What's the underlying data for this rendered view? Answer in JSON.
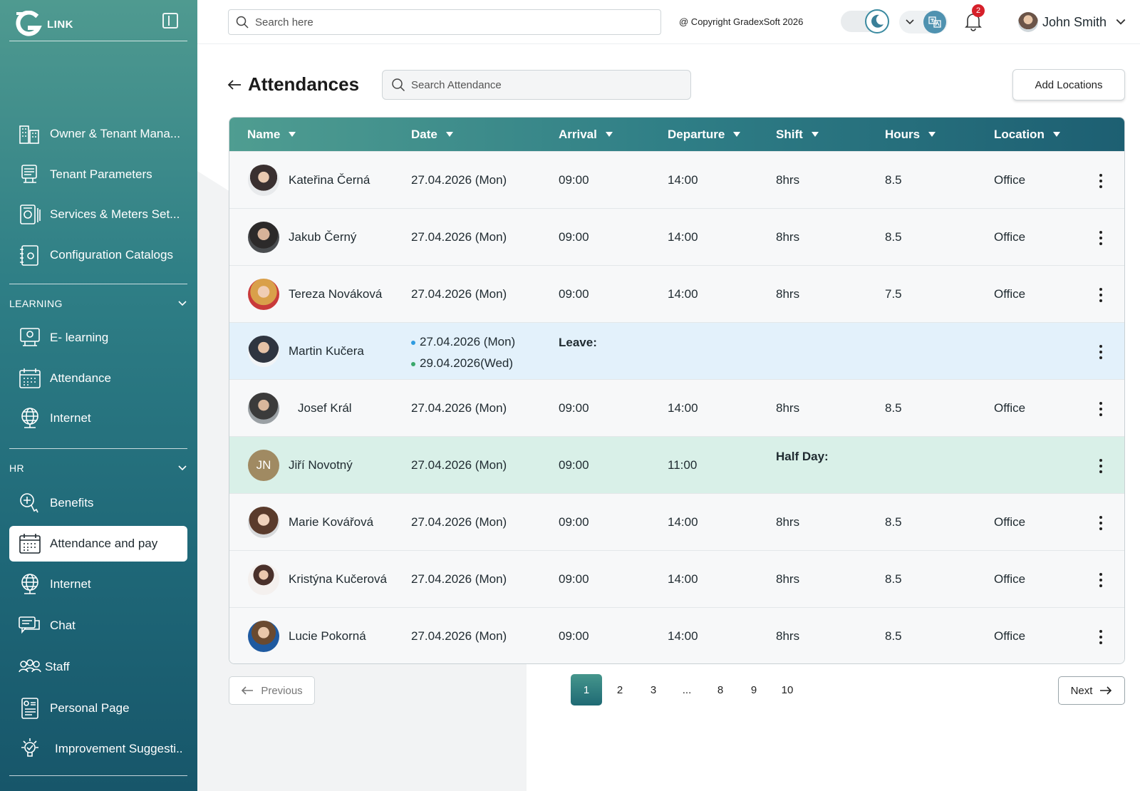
{
  "sidebar": {
    "logo_text": "LINK",
    "top_items": [
      {
        "label": "Owner & Tenant Mana...",
        "icon": "buildings-icon"
      },
      {
        "label": "Tenant Parameters",
        "icon": "parameters-icon"
      },
      {
        "label": "Services & Meters Set...",
        "icon": "meters-icon"
      },
      {
        "label": "Configuration Catalogs",
        "icon": "catalog-icon"
      }
    ],
    "sections": [
      {
        "label": "LEARNING",
        "items": [
          {
            "label": "E- learning",
            "icon": "elearning-icon"
          },
          {
            "label": "Attendance",
            "icon": "calendar-icon"
          },
          {
            "label": "Internet",
            "icon": "globe-icon"
          }
        ]
      },
      {
        "label": "HR",
        "items": [
          {
            "label": "Benefits",
            "icon": "benefits-icon"
          },
          {
            "label": "Attendance and pay",
            "icon": "calendar-icon",
            "active": true
          },
          {
            "label": "Internet",
            "icon": "globe-icon"
          },
          {
            "label": "Chat",
            "icon": "chat-icon"
          },
          {
            "label": "Staff",
            "icon": "staff-icon"
          },
          {
            "label": "Personal Page",
            "icon": "personal-page-icon"
          },
          {
            "label": "Improvement Suggesti..",
            "icon": "lightbulb-icon"
          }
        ]
      }
    ]
  },
  "topbar": {
    "search_placeholder": "Search here",
    "copyright": "@ Copyright GradexSoft 2026",
    "notification_count": "2",
    "user_name": "John Smith"
  },
  "page": {
    "title": "Attendances",
    "search_placeholder": "Search Attendance",
    "add_button": "Add Locations"
  },
  "table": {
    "columns": [
      "Name",
      "Date",
      "Arrival",
      "Departure",
      "Shift",
      "Hours",
      "Location"
    ],
    "rows": [
      {
        "name": "Kateřina Černá",
        "date": "27.04.2026 (Mon)",
        "arrival": "09:00",
        "departure": "14:00",
        "shift": "8hrs",
        "hours": "8.5",
        "location": "Office",
        "type": "normal"
      },
      {
        "name": "Jakub Černý",
        "date": "27.04.2026 (Mon)",
        "arrival": "09:00",
        "departure": "14:00",
        "shift": "8hrs",
        "hours": "8.5",
        "location": "Office",
        "type": "normal"
      },
      {
        "name": "Tereza Nováková",
        "date": "27.04.2026 (Mon)",
        "arrival": "09:00",
        "departure": "14:00",
        "shift": "8hrs",
        "hours": "7.5",
        "location": "Office",
        "type": "normal"
      },
      {
        "name": "Martin Kučera",
        "dates": [
          "27.04.2026 (Mon)",
          "29.04.2026(Wed)"
        ],
        "note": "Leave:",
        "type": "leave"
      },
      {
        "name": "Josef Král",
        "date": "27.04.2026 (Mon)",
        "arrival": "09:00",
        "departure": "14:00",
        "shift": "8hrs",
        "hours": "8.5",
        "location": "Office",
        "type": "normal"
      },
      {
        "name": "Jiří Novotný",
        "initials": "JN",
        "date": "27.04.2026 (Mon)",
        "arrival": "09:00",
        "departure": "11:00",
        "note": "Half Day:",
        "type": "half"
      },
      {
        "name": "Marie Kovářová",
        "date": "27.04.2026 (Mon)",
        "arrival": "09:00",
        "departure": "14:00",
        "shift": "8hrs",
        "hours": "8.5",
        "location": "Office",
        "type": "normal"
      },
      {
        "name": "Kristýna Kučerová",
        "date": "27.04.2026 (Mon)",
        "arrival": "09:00",
        "departure": "14:00",
        "shift": "8hrs",
        "hours": "8.5",
        "location": "Office",
        "type": "normal"
      },
      {
        "name": "Lucie Pokorná",
        "date": "27.04.2026 (Mon)",
        "arrival": "09:00",
        "departure": "14:00",
        "shift": "8hrs",
        "hours": "8.5",
        "location": "Office",
        "type": "normal"
      }
    ]
  },
  "pagination": {
    "previous": "Previous",
    "next": "Next",
    "pages": [
      "1",
      "2",
      "3",
      "...",
      "8",
      "9",
      "10"
    ],
    "current": "1"
  },
  "colors": {
    "accent": "#2f7e86",
    "leave_row": "#e3f1fb",
    "half_day_row": "#d9f0e8",
    "leave_dot": "#2f9be0",
    "half_dot": "#3aa86b"
  }
}
